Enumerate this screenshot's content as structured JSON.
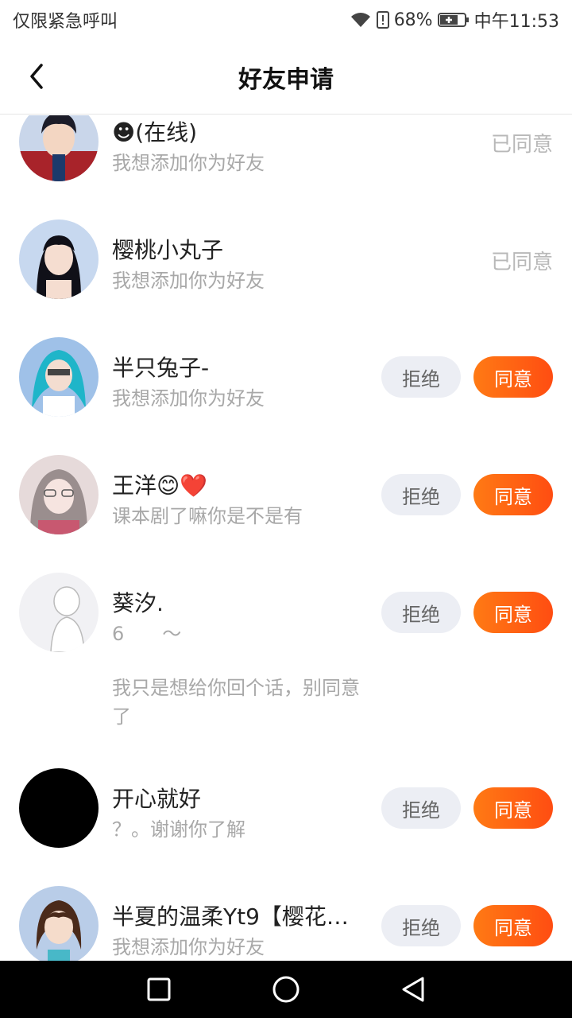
{
  "status_bar": {
    "left_text": "仅限紧急呼叫",
    "battery": "68%",
    "time": "中午11:53"
  },
  "header": {
    "title": "好友申请",
    "back_icon": "chevron-left-icon"
  },
  "requests": [
    {
      "name": "☻(在线)",
      "message": "我想添加你为好友",
      "status": "已同意"
    },
    {
      "name": "樱桃小丸子",
      "message": "我想添加你为好友",
      "status": "已同意"
    },
    {
      "name": "半只兔子-",
      "message": "我想添加你为好友",
      "reject": "拒绝",
      "accept": "同意"
    },
    {
      "name": "王洋😊❤️",
      "message": "课本剧了嘛你是不是有",
      "reject": "拒绝",
      "accept": "同意"
    },
    {
      "name": "葵汐.",
      "message": "6　　～",
      "extra_message": "我只是想给你回个话，别同意了",
      "reject": "拒绝",
      "accept": "同意"
    },
    {
      "name": "开心就好",
      "message": "？。谢谢你了解",
      "reject": "拒绝",
      "accept": "同意"
    },
    {
      "name": "半夏的温柔Yt9【樱花…",
      "message": "我想添加你为好友",
      "reject": "拒绝",
      "accept": "同意"
    }
  ],
  "colors": {
    "accent": "#ff5a14",
    "reject_bg": "#eceef4",
    "muted": "#a8a8a8"
  }
}
